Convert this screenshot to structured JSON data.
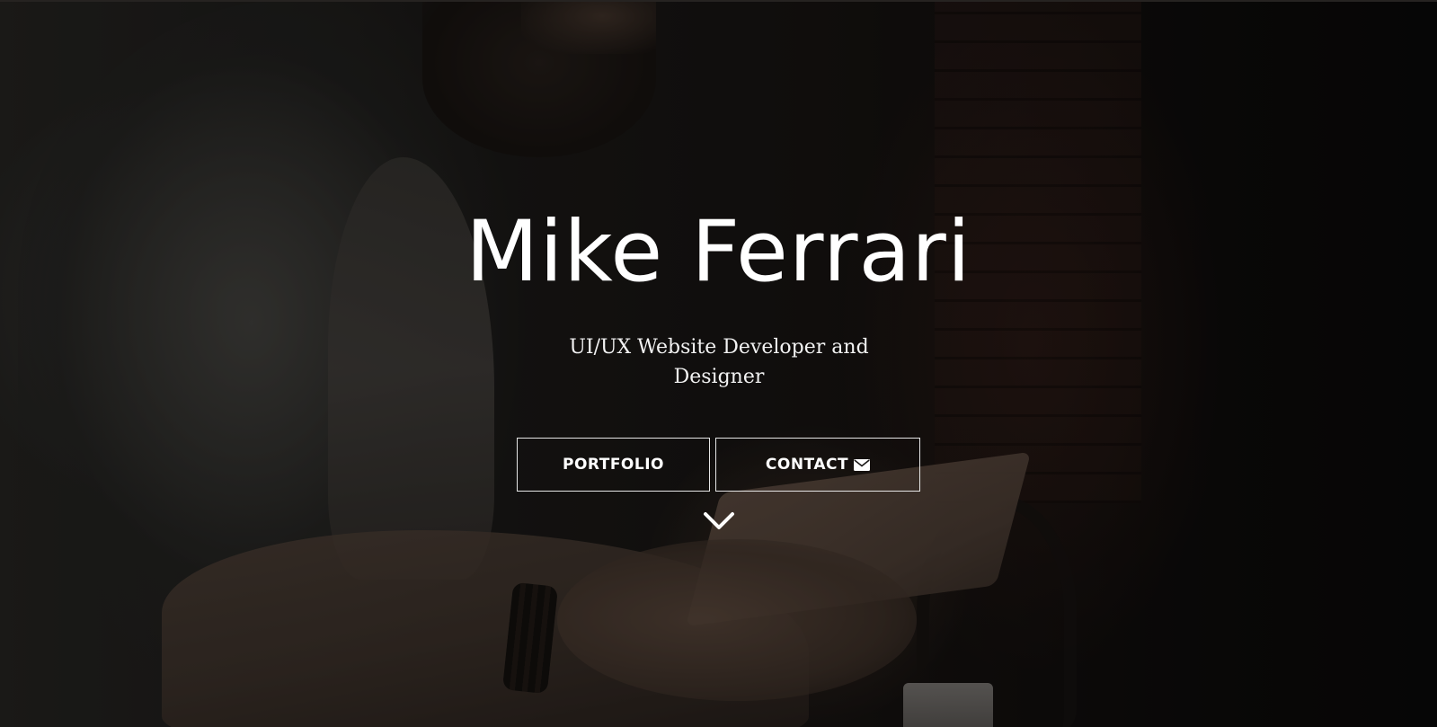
{
  "hero": {
    "name": "Mike Ferrari",
    "tagline": "UI/UX Website Developer and Designer"
  },
  "buttons": {
    "portfolio_label": "PORTFOLIO",
    "contact_label": "CONTACT"
  },
  "icons": {
    "contact": "envelope-icon",
    "scroll": "chevron-down-icon"
  },
  "colors": {
    "text": "#ffffff",
    "button_border": "#e6e6e6",
    "background": "#0d0c0b"
  }
}
